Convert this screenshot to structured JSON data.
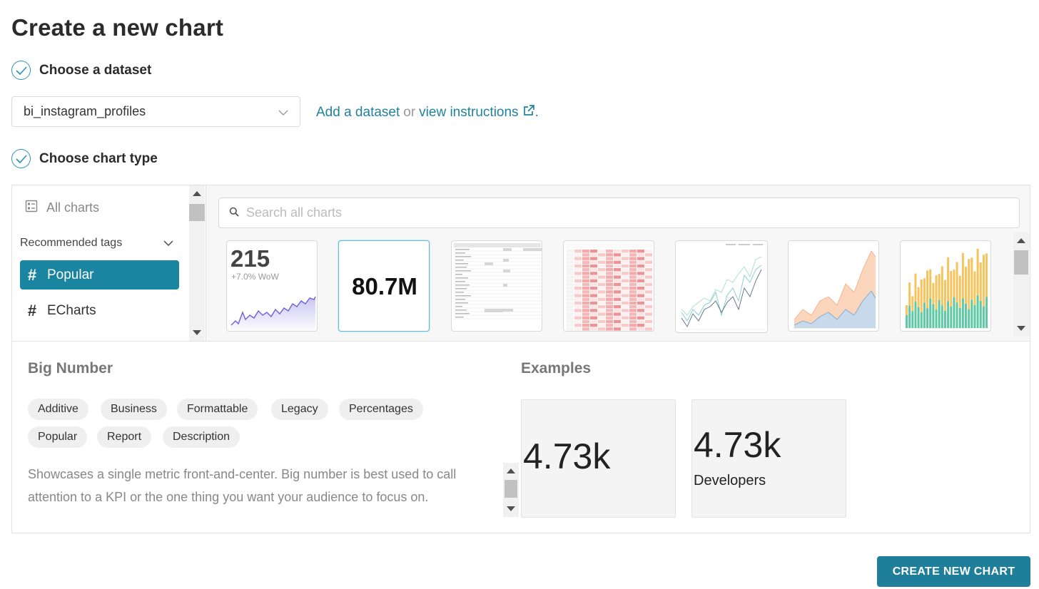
{
  "page": {
    "title": "Create a new chart"
  },
  "steps": {
    "dataset": {
      "label": "Choose a dataset"
    },
    "chart_type": {
      "label": "Choose chart type"
    }
  },
  "dataset": {
    "selected": "bi_instagram_profiles",
    "add_link": "Add a dataset",
    "or_text": "or",
    "instructions_link": "view instructions",
    "period": "."
  },
  "sidebar": {
    "all_charts": "All charts",
    "recommended_tags": "Recommended tags",
    "tags": [
      {
        "label": "Popular"
      },
      {
        "label": "ECharts"
      }
    ]
  },
  "search": {
    "placeholder": "Search all charts"
  },
  "thumbnails": {
    "big_number_trendline": {
      "value": "215",
      "delta": "+7.0% WoW"
    },
    "big_number": {
      "value": "80.7M"
    }
  },
  "details": {
    "title": "Big Number",
    "tags": [
      "Additive",
      "Business",
      "Formattable",
      "Legacy",
      "Percentages",
      "Popular",
      "Report",
      "Description"
    ],
    "description": "Showcases a single metric front-and-center. Big number is best used to call attention to a KPI or the one thing you want your audience to focus on.",
    "examples_title": "Examples",
    "examples": [
      {
        "value": "4.73k",
        "subheader": ""
      },
      {
        "value": "4.73k",
        "subheader": "Developers"
      }
    ]
  },
  "actions": {
    "create_label": "CREATE NEW CHART"
  },
  "colors": {
    "accent": "#1a85a0",
    "link": "#20839e",
    "button": "#1f7f9b"
  }
}
